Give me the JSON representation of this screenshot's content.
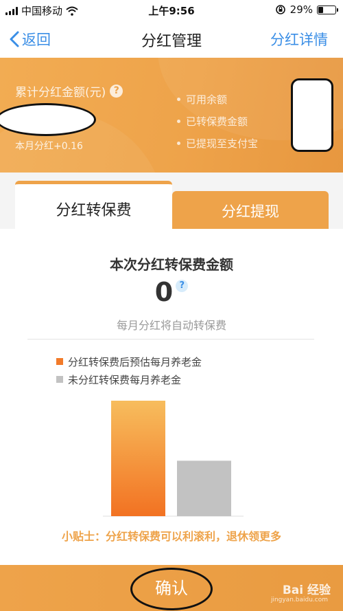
{
  "status_bar": {
    "carrier": "中国移动",
    "time": "上午9:56",
    "battery": "29%",
    "battery_level": 0.29
  },
  "nav": {
    "back_label": "返回",
    "title": "分红管理",
    "right_link": "分红详情"
  },
  "summary": {
    "cumulative_label": "累计分红金额(元)",
    "help_glyph": "?",
    "month_dividend": "本月分红+0.16",
    "items": [
      "可用余额",
      "已转保费金额",
      "已提现至支付宝"
    ]
  },
  "tabs": [
    {
      "label": "分红转保费",
      "active": true
    },
    {
      "label": "分红提现",
      "active": false
    }
  ],
  "main": {
    "section_title": "本次分红转保费金额",
    "amount": "0",
    "question_glyph": "?",
    "auto_note": "每月分红将自动转保费",
    "tip": "小贴士：分红转保费可以利滚利，退休领更多"
  },
  "chart_data": {
    "type": "bar",
    "series": [
      {
        "name": "分红转保费后预估每月养老金",
        "color": "#f27b2a",
        "relative_value": 1.0
      },
      {
        "name": "未分红转保费每月养老金",
        "color": "#c2c2c2",
        "relative_value": 0.48
      }
    ]
  },
  "bottom": {
    "confirm_label": "确认",
    "watermark": "Bai 经验",
    "watermark_sub": "jingyan.baidu.com"
  },
  "colors": {
    "accent": "#eea34a",
    "link": "#3a8ee6"
  }
}
